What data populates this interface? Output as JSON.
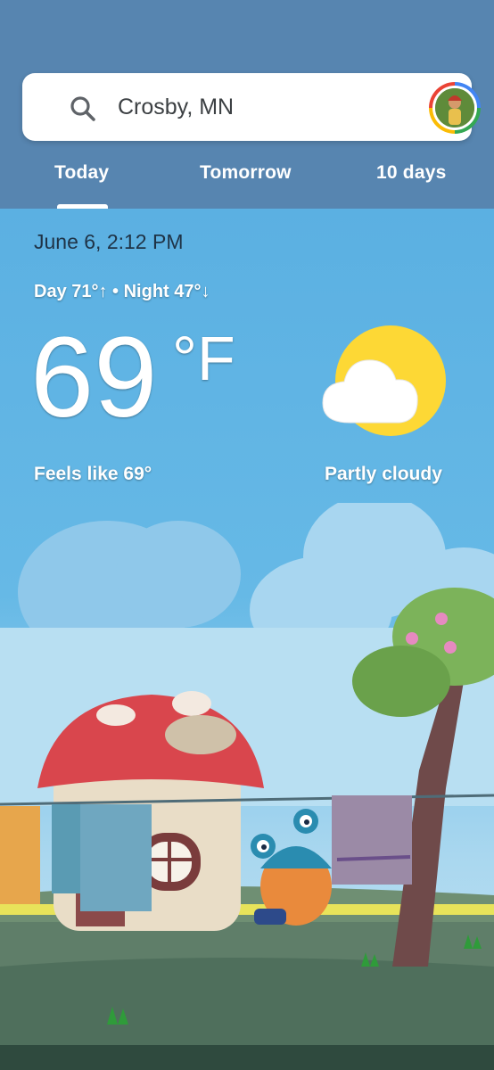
{
  "search": {
    "location": "Crosby, MN",
    "icon": "search-icon"
  },
  "tabs": [
    {
      "label": "Today",
      "selected": true
    },
    {
      "label": "Tomorrow",
      "selected": false
    },
    {
      "label": "10 days",
      "selected": false
    }
  ],
  "weather": {
    "date_time": "June 6, 2:12 PM",
    "day_night": "Day 71°↑ • Night 47°↓",
    "temperature": "69",
    "unit": "°F",
    "feels_like": "Feels like 69°",
    "condition": "Partly cloudy",
    "condition_icon": "partly-cloudy-icon"
  },
  "colors": {
    "header": "#5785b0",
    "sky": "#5bb0e2",
    "sun": "#fdd835",
    "accent": "#ffffff"
  }
}
